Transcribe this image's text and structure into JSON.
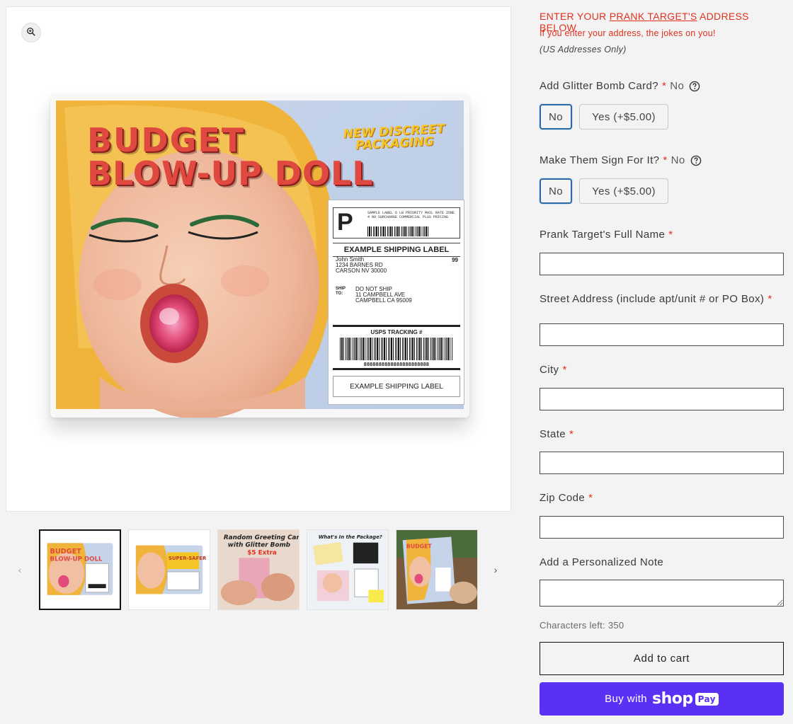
{
  "media": {
    "zoom_icon": "zoom-in-icon",
    "product": {
      "title_line1": "BUDGET",
      "title_line2": "BLOW-UP DOLL",
      "tagline": "NEW DISCREET PACKAGING",
      "shipping_label": {
        "priority_letter": "P",
        "mini_text": "SAMPLE LABEL 6 LB PRIORITY MAIL RATE ZONE 4 NO SURCHARGE COMMERCIAL PLUS PRICING",
        "heading": "EXAMPLE SHIPPING LABEL",
        "from_name": "John Smith",
        "from_street": "1234 BARNES RD",
        "from_city": "CARSON NV 30000",
        "code": "99",
        "ship_to_label": "SHIP TO:",
        "to_line1": "DO NOT SHIP",
        "to_line2": "11 CAMPBELL AVE",
        "to_line3": "CAMPBELL CA 95009",
        "tracking_title": "USPS TRACKING #",
        "tracking_number": "8888888888888888888888",
        "footer": "EXAMPLE SHIPPING LABEL"
      }
    },
    "thumbnails": [
      {
        "name": "thumb-budget-doll",
        "caption": "BUDGET BLOW-UP DOLL"
      },
      {
        "name": "thumb-super-safer",
        "caption": "SUPER-SAFER"
      },
      {
        "name": "thumb-greeting-card",
        "caption": "Random Greeting Card with Glitter Bomb",
        "price_note": "$5 Extra"
      },
      {
        "name": "thumb-whats-in-package",
        "caption": "What's In the Package?"
      },
      {
        "name": "thumb-doorstep",
        "caption": "BUDGET BLOW-UP DOLL"
      }
    ],
    "prev_icon": "chevron-left-icon",
    "next_icon": "chevron-right-icon"
  },
  "form": {
    "warning_pre": "ENTER YOUR ",
    "warning_link": "PRANK TARGET'S",
    "warning_post": " ADDRESS BELOW",
    "warning_sub": "If you enter your address, the jokes on you!",
    "warning_note": "(US Addresses Only)",
    "options": [
      {
        "label": "Add Glitter Bomb Card?",
        "required": "*",
        "value": "No",
        "help_icon": "question-circle-icon",
        "choices": [
          "No",
          "Yes  (+$5.00)"
        ],
        "selected": "No"
      },
      {
        "label": "Make Them Sign For It?",
        "required": "*",
        "value": "No",
        "help_icon": "question-circle-icon",
        "choices": [
          "No",
          "Yes  (+$5.00)"
        ],
        "selected": "No"
      }
    ],
    "fields": {
      "full_name": {
        "label": "Prank Target's Full Name",
        "required": "*",
        "value": ""
      },
      "street": {
        "label": "Street Address (include apt/unit # or PO Box)",
        "required": "*",
        "value": ""
      },
      "city": {
        "label": "City",
        "required": "*",
        "value": ""
      },
      "state": {
        "label": "State",
        "required": "*",
        "value": ""
      },
      "zip": {
        "label": "Zip Code",
        "required": "*",
        "value": ""
      },
      "note": {
        "label": "Add a Personalized Note",
        "value": ""
      }
    },
    "chars_left": "Characters left: 350",
    "add_to_cart": "Add to cart",
    "buy_with": "Buy with",
    "shop_word": "shop",
    "pay_word": "Pay"
  },
  "colors": {
    "accent_red": "#e0301e",
    "shop_purple": "#5a31f4",
    "selected_blue": "#2b6aa6"
  }
}
